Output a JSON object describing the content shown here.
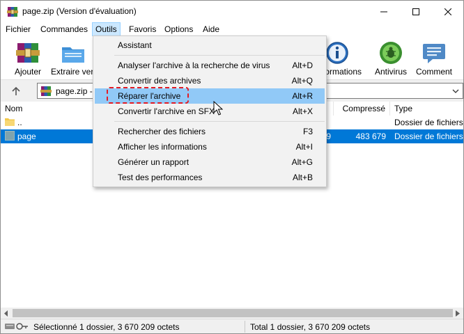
{
  "window": {
    "title": "page.zip (Version d'évaluation)",
    "controls": {
      "minimize": "minimize-icon",
      "maximize": "maximize-icon",
      "close": "close-icon"
    }
  },
  "menubar": {
    "items": [
      {
        "label": "Fichier"
      },
      {
        "label": "Commandes"
      },
      {
        "label": "Outils",
        "active": true
      },
      {
        "label": "Favoris"
      },
      {
        "label": "Options"
      },
      {
        "label": "Aide"
      }
    ]
  },
  "toolbar": {
    "buttons": [
      {
        "label": "Ajouter",
        "icon": "add-archive-icon"
      },
      {
        "label": "Extraire vers",
        "icon": "extract-icon"
      },
      {
        "label": "Informations",
        "icon": "info-icon"
      },
      {
        "label": "Antivirus",
        "icon": "antivirus-icon"
      },
      {
        "label": "Comment",
        "icon": "comment-icon"
      }
    ]
  },
  "address": {
    "path": "page.zip -"
  },
  "filelist": {
    "columns": {
      "name": "Nom",
      "packed": "Compressé",
      "type": "Type"
    },
    "rows": [
      {
        "name": "..",
        "size_tail": "",
        "packed": "",
        "type": "Dossier de fichiers"
      },
      {
        "name": "page",
        "size_tail": "9",
        "packed": "483 679",
        "type": "Dossier de fichiers",
        "selected": true
      }
    ]
  },
  "dropdown": {
    "menu": "Outils",
    "items": [
      {
        "label": "Assistant",
        "shortcut": ""
      },
      {
        "label": "Analyser l'archive à la recherche de virus",
        "shortcut": "Alt+D"
      },
      {
        "label": "Convertir des archives",
        "shortcut": "Alt+Q"
      },
      {
        "label": "Réparer l'archive",
        "shortcut": "Alt+R",
        "highlighted": true
      },
      {
        "label": "Convertir l'archive en SFX",
        "shortcut": "Alt+X"
      },
      {
        "label": "Rechercher des fichiers",
        "shortcut": "F3"
      },
      {
        "label": "Afficher les informations",
        "shortcut": "Alt+I"
      },
      {
        "label": "Générer un rapport",
        "shortcut": "Alt+G"
      },
      {
        "label": "Test des performances",
        "shortcut": "Alt+B"
      }
    ]
  },
  "statusbar": {
    "left": "Sélectionné 1 dossier, 3 670 209 octets",
    "right": "Total 1 dossier, 3 670 209 octets"
  },
  "colors": {
    "selection": "#0078d7",
    "menu_highlight": "#91c9f7",
    "annotation": "#e31b23"
  }
}
